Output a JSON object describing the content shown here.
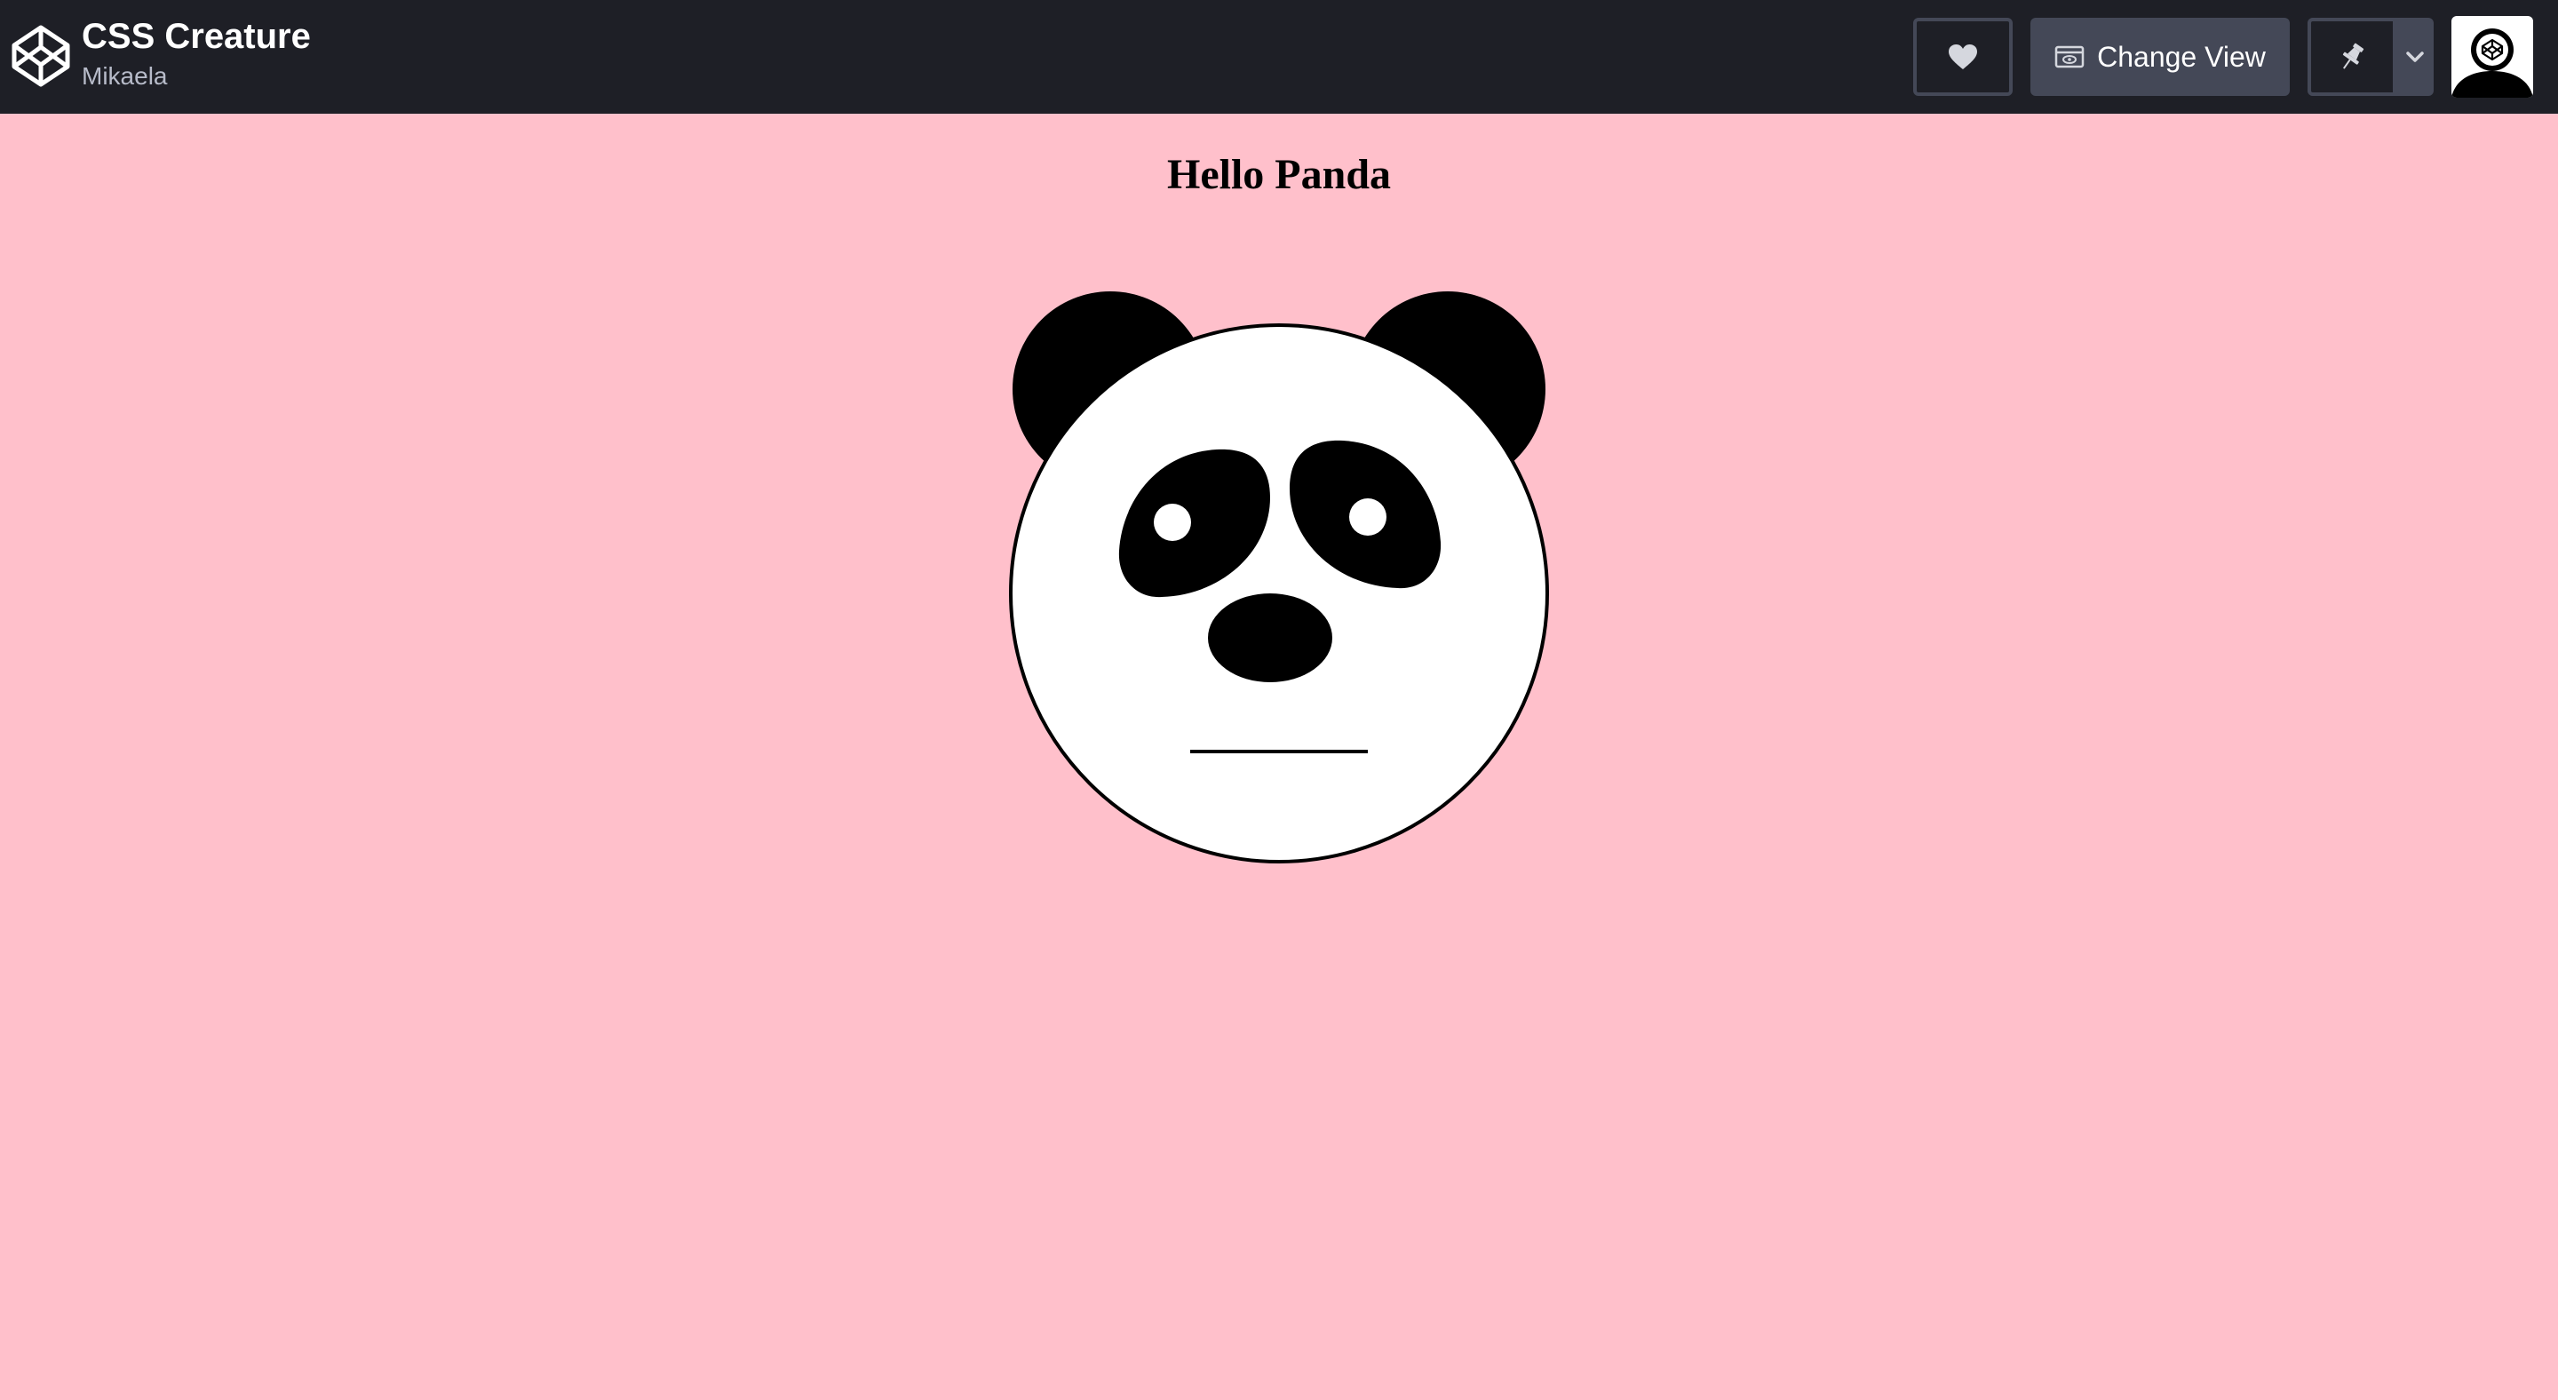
{
  "header": {
    "pen_title": "CSS Creature",
    "author": "Mikaela",
    "change_view_label": "Change View",
    "logo_icon": "codepen-logo-icon",
    "heart_icon": "heart-icon",
    "view_icon": "change-view-icon",
    "pin_icon": "pin-icon",
    "caret_icon": "chevron-down-icon",
    "avatar_icon": "user-avatar"
  },
  "main": {
    "heading": "Hello Panda"
  },
  "colors": {
    "background": "#ffc0cb",
    "topbar": "#1e1f26",
    "button": "#444857",
    "panda_face": "#ffffff",
    "panda_black": "#000000"
  }
}
